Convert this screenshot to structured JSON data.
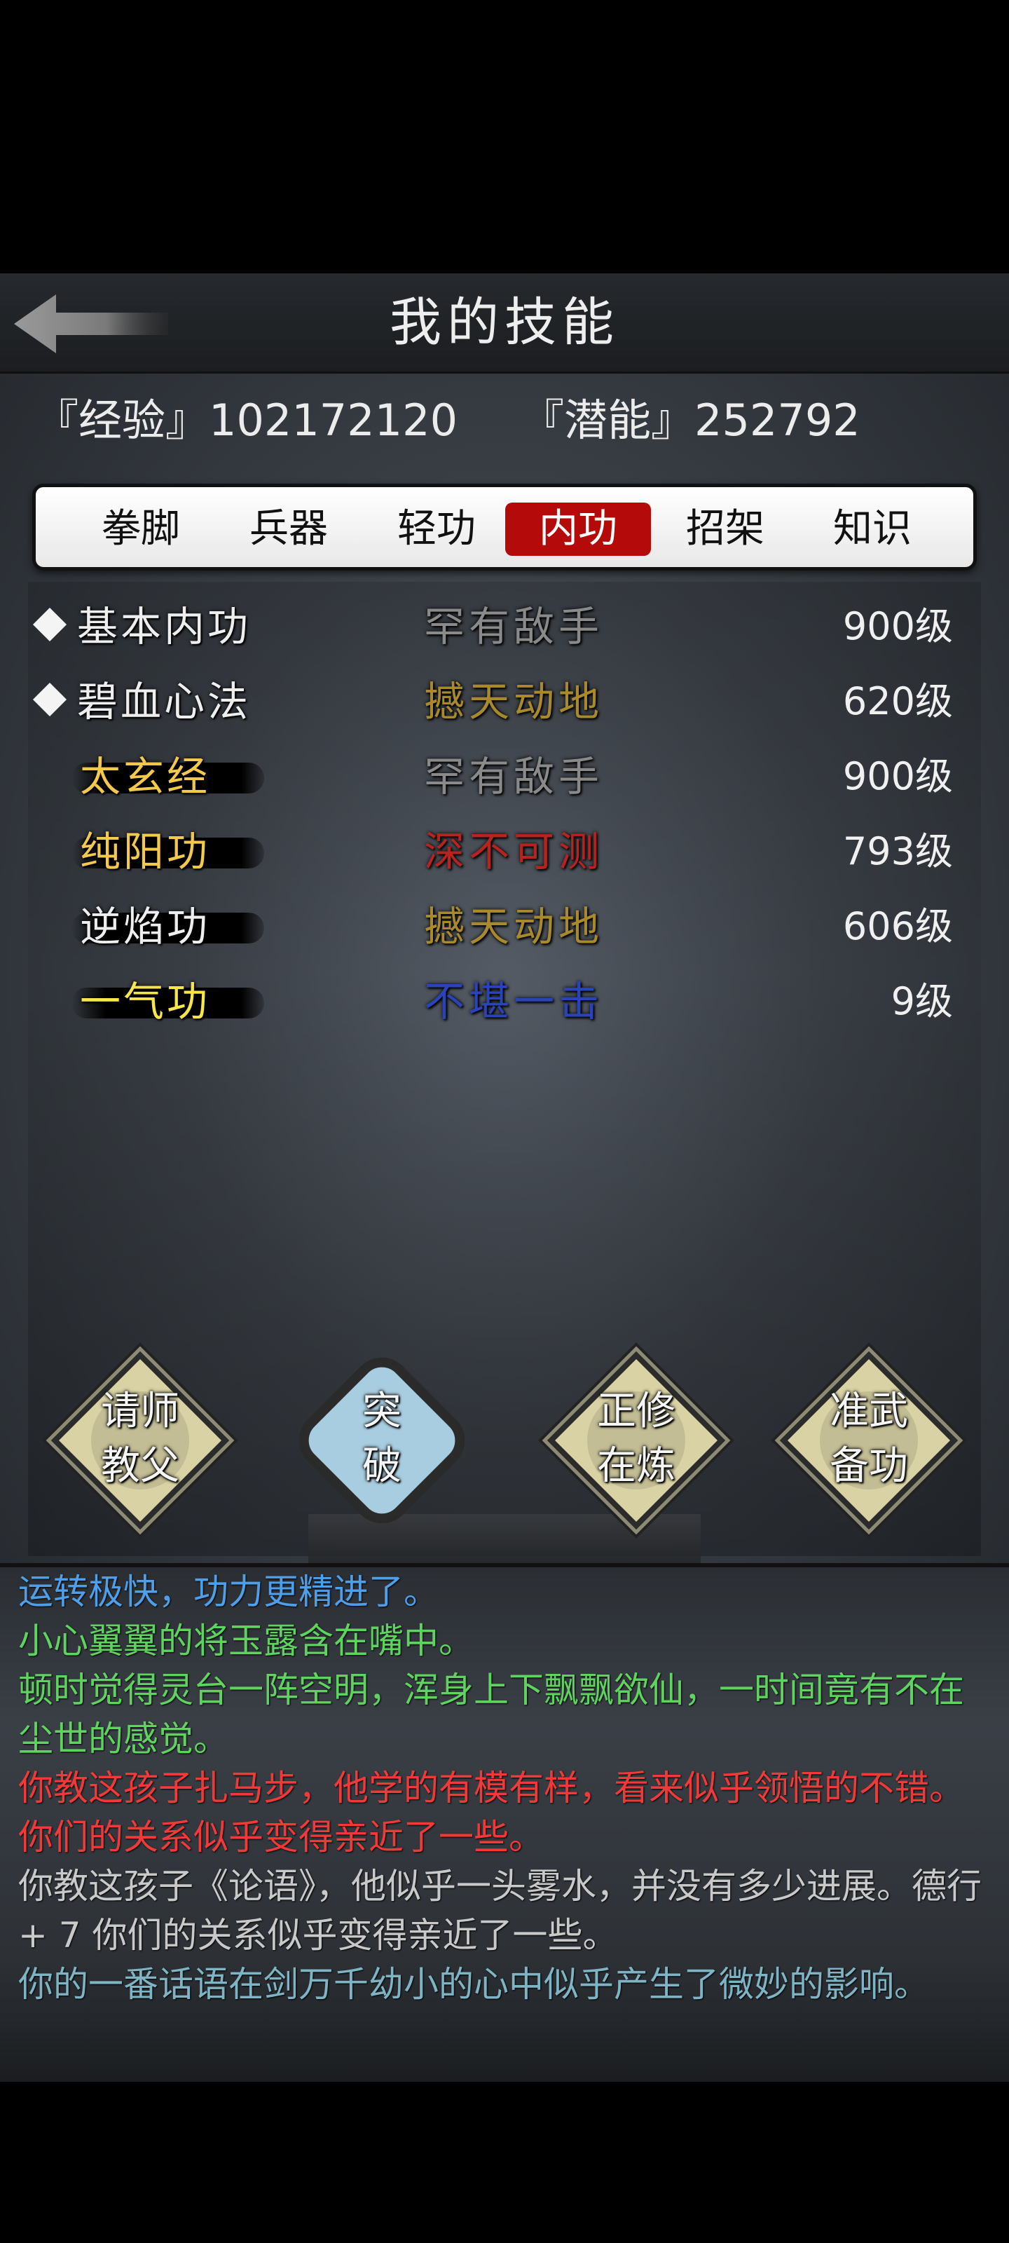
{
  "header": {
    "title": "我的技能"
  },
  "stats": {
    "experience": "『经验』102172120",
    "potential": "『潜能』252792"
  },
  "tabs": [
    {
      "label": "拳脚",
      "active": false
    },
    {
      "label": "兵器",
      "active": false
    },
    {
      "label": "轻功",
      "active": false
    },
    {
      "label": "内功",
      "active": true
    },
    {
      "label": "招架",
      "active": false
    },
    {
      "label": "知识",
      "active": false
    }
  ],
  "skills": [
    {
      "name": "基本内功",
      "rank": "罕有敌手",
      "level": "900级",
      "name_color": "#eeeeee",
      "rank_color": "#8a8a8a",
      "marked": true
    },
    {
      "name": "碧血心法",
      "rank": "撼天动地",
      "level": "620级",
      "name_color": "#eeeeee",
      "rank_color": "#a8892c",
      "marked": true
    },
    {
      "name": "太玄经",
      "rank": "罕有敌手",
      "level": "900级",
      "name_color": "#f2c94c",
      "rank_color": "#8a8a8a",
      "marked": false
    },
    {
      "name": "纯阳功",
      "rank": "深不可测",
      "level": "793级",
      "name_color": "#f2c94c",
      "rank_color": "#b8231f",
      "marked": false
    },
    {
      "name": "逆焰功",
      "rank": "撼天动地",
      "level": "606级",
      "name_color": "#eeeeee",
      "rank_color": "#a8892c",
      "marked": false
    },
    {
      "name": "一气功",
      "rank": "不堪一击",
      "level": "9级",
      "name_color": "#f7e64a",
      "rank_color": "#2a43b8",
      "marked": false
    }
  ],
  "actions": [
    {
      "label_top": "请师",
      "label_bottom": "教父"
    },
    {
      "label_top": "突",
      "label_bottom": "破"
    },
    {
      "label_top": "正修",
      "label_bottom": "在炼"
    },
    {
      "label_top": "准武",
      "label_bottom": "备功"
    }
  ],
  "log": [
    {
      "text": "运转极快，功力更精进了。",
      "color": "#4f9fe8"
    },
    {
      "text": "小心翼翼的将玉露含在嘴中。",
      "color": "#5fd35f"
    },
    {
      "text": "顿时觉得灵台一阵空明，浑身上下飘飘欲仙，一时间竟有不在尘世的感觉。",
      "color": "#5fd35f"
    },
    {
      "text": "你教这孩子扎马步，他学的有模有样，看来似乎领悟的不错。 你们的关系似乎变得亲近了一些。",
      "color": "#f03a3a"
    },
    {
      "text": "你教这孩子《论语》，他似乎一头雾水，并没有多少进展。德行 + 7 你们的关系似乎变得亲近了一些。",
      "color": "#c9c9c9"
    },
    {
      "text": "你的一番话语在剑万千幼小的心中似乎产生了微妙的影响。",
      "color": "#7fb4c4"
    }
  ],
  "colors": {
    "active_tab": "#b50a0a",
    "panel_bg": "#3b4047"
  }
}
